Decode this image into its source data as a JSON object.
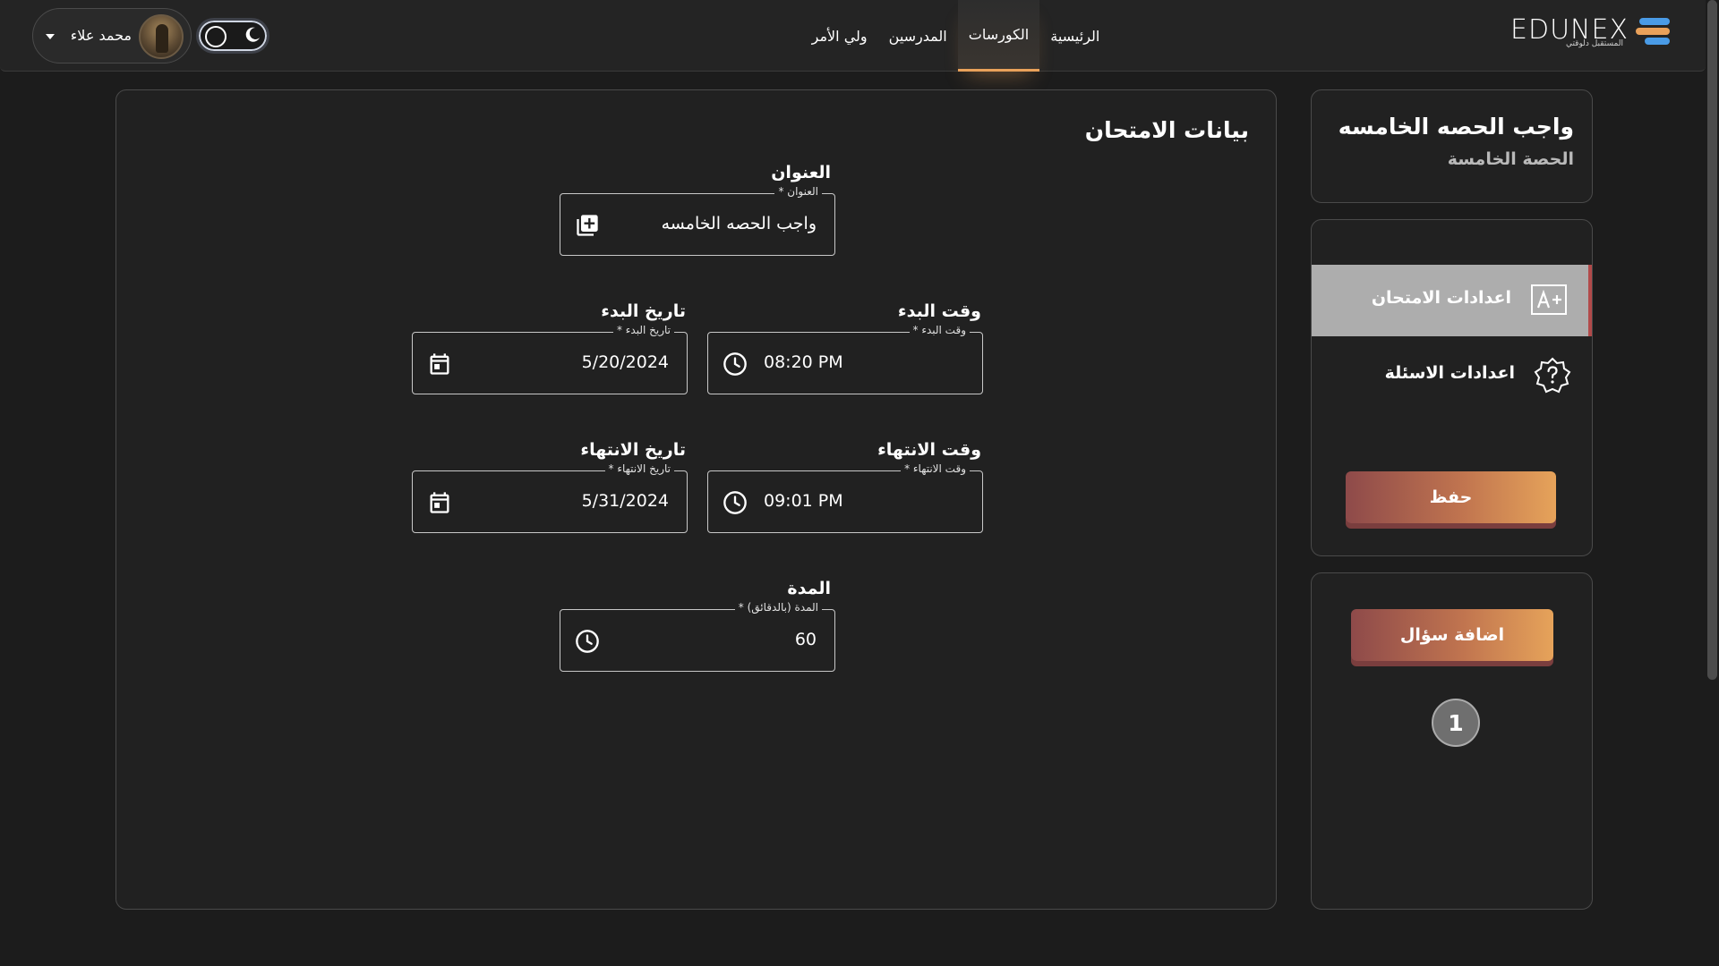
{
  "header": {
    "logo_text": "EDUNEX",
    "logo_tagline": "المستقبل دلوقتي",
    "nav": [
      {
        "label": "الرئيسية",
        "active": false
      },
      {
        "label": "الكورسات",
        "active": true
      },
      {
        "label": "المدرسين",
        "active": false
      },
      {
        "label": "ولي الأمر",
        "active": false
      }
    ],
    "user_name": "محمد علاء",
    "theme": "dark"
  },
  "exam_card": {
    "title": "واجب الحصه الخامسه",
    "subtitle": "الحصة الخامسة"
  },
  "settings_menu": {
    "items": [
      {
        "label": "اعدادات الامتحان",
        "icon": "exam-a-plus-icon",
        "active": true
      },
      {
        "label": "اعدادات الاسئلة",
        "icon": "question-badge-icon",
        "active": false
      }
    ],
    "save_label": "حفظ"
  },
  "questions_panel": {
    "add_label": "اضافة سؤال",
    "questions": [
      "1"
    ]
  },
  "form": {
    "heading": "بيانات الامتحان",
    "title_field": {
      "label": "العنوان",
      "legend": "العنوان *",
      "value": "واجب الحصه الخامسه",
      "icon": "library-add-icon"
    },
    "start_time": {
      "label": "وقت البدء",
      "legend": "وقت البدء *",
      "value": "08:20 PM",
      "icon": "clock-icon"
    },
    "start_date": {
      "label": "تاريخ البدء",
      "legend": "تاريخ البدء *",
      "value": "5/20/2024",
      "icon": "calendar-icon"
    },
    "end_time": {
      "label": "وقت الانتهاء",
      "legend": "وقت الانتهاء *",
      "value": "09:01 PM",
      "icon": "clock-icon"
    },
    "end_date": {
      "label": "تاريخ الانتهاء",
      "legend": "تاريخ الانتهاء *",
      "value": "5/31/2024",
      "icon": "calendar-icon"
    },
    "duration": {
      "label": "المدة",
      "legend": "المدة (بالدقائق) *",
      "value": "60",
      "icon": "clock-icon"
    }
  },
  "colors": {
    "accent": "#e9a15a",
    "button_gradient_start": "#8e4a4a",
    "button_gradient_end": "#e6a35a",
    "active_menu_bg": "#adadad",
    "background": "#1c1c1c",
    "card_bg": "#212121"
  }
}
